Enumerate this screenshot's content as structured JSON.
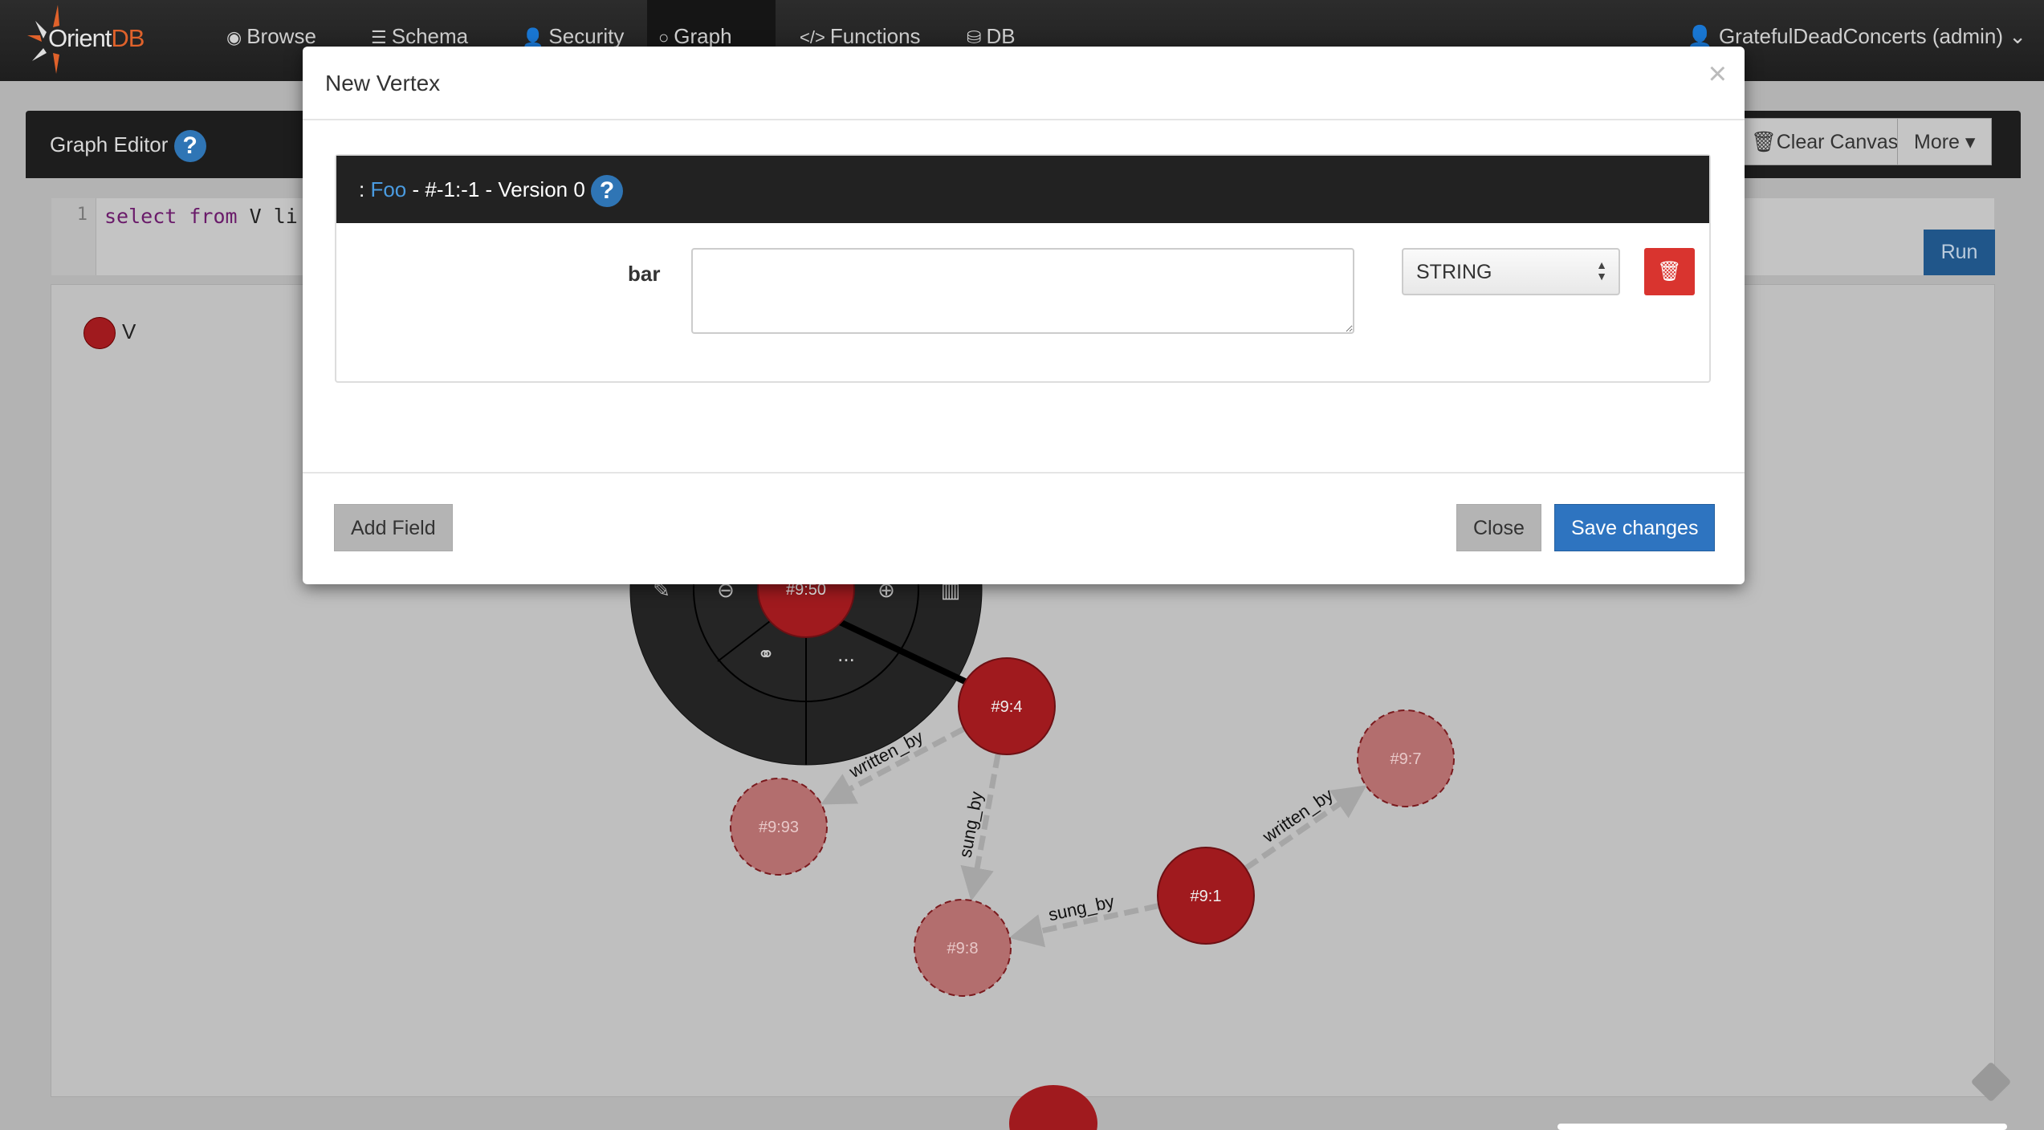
{
  "navbar": {
    "brand": {
      "name": "Orient",
      "suffix": "DB"
    },
    "items": [
      {
        "label": "Browse",
        "icon": "eye-icon"
      },
      {
        "label": "Schema",
        "icon": "table-icon"
      },
      {
        "label": "Security",
        "icon": "user-icon"
      },
      {
        "label": "Graph",
        "icon": "circle-icon",
        "active": true
      },
      {
        "label": "Functions",
        "icon": "code-icon"
      },
      {
        "label": "DB",
        "icon": "database-icon"
      }
    ],
    "user": "GratefulDeadConcerts (admin)"
  },
  "graph_editor": {
    "title": "Graph Editor",
    "help": "?",
    "clear_canvas": "Clear Canvas",
    "more": "More",
    "run": "Run",
    "query": {
      "line": "1",
      "kw1": "select",
      "kw2": "from",
      "rest": " V li"
    },
    "legend": [
      {
        "label": "V",
        "color": "#a01a1e"
      }
    ],
    "nodes": [
      {
        "id": "#9:50",
        "state": "selected"
      },
      {
        "id": "#9:4",
        "state": "normal"
      },
      {
        "id": "#9:93",
        "state": "faded"
      },
      {
        "id": "#9:8",
        "state": "faded"
      },
      {
        "id": "#9:1",
        "state": "normal"
      },
      {
        "id": "#9:7",
        "state": "faded"
      }
    ],
    "edges": [
      {
        "from": "#9:4",
        "to": "#9:93",
        "label": "written_by"
      },
      {
        "from": "#9:4",
        "to": "#9:8",
        "label": "sung_by"
      },
      {
        "from": "#9:1",
        "to": "#9:8",
        "label": "sung_by"
      },
      {
        "from": "#9:1",
        "to": "#9:7",
        "label": "written_by"
      }
    ],
    "radial_menu_items": [
      "edit-icon",
      "back-icon",
      "forward-icon",
      "trash-icon",
      "link-icon",
      "more-icon"
    ],
    "more_label": "..."
  },
  "modal": {
    "title": "New Vertex",
    "close_x": "×",
    "header": {
      "prefix": ": ",
      "class": "Foo",
      "rest": " - #-1:-1 - Version 0",
      "help": "?"
    },
    "field": {
      "name": "bar",
      "value": "",
      "type": "STRING"
    },
    "add_field": "Add Field",
    "close": "Close",
    "save": "Save changes"
  },
  "colors": {
    "node": "#a01a1e",
    "faded_node": "#b36e6e",
    "primary": "#2e74c0",
    "danger": "#d9342f"
  }
}
